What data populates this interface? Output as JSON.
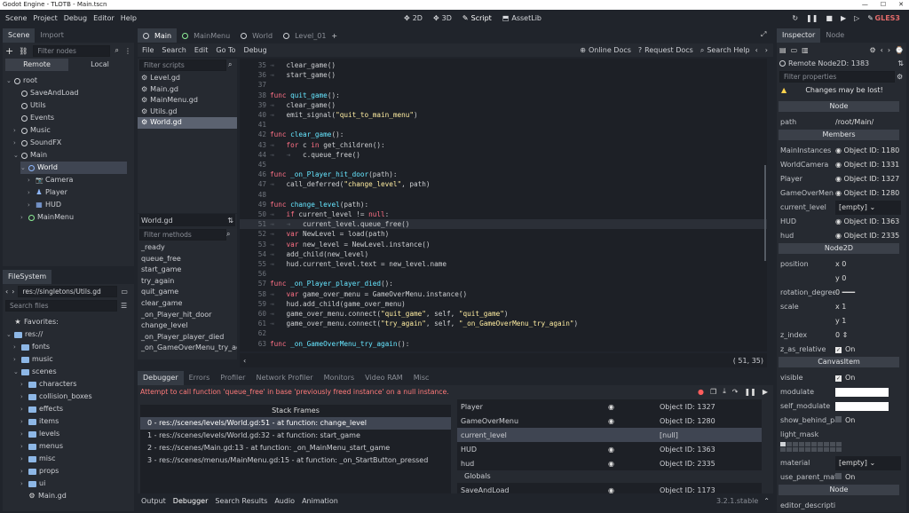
{
  "titlebar": {
    "title": "Godot Engine - TLOTB - Main.tscn"
  },
  "menu": [
    "Scene",
    "Project",
    "Debug",
    "Editor",
    "Help"
  ],
  "main_buttons": [
    {
      "label": "2D",
      "icon": "2d-icon"
    },
    {
      "label": "3D",
      "icon": "3d-icon"
    },
    {
      "label": "Script",
      "icon": "script-icon",
      "active": true
    },
    {
      "label": "AssetLib",
      "icon": "assetlib-icon"
    }
  ],
  "renderer": "GLES3",
  "scene_panel": {
    "tabs": [
      "Scene",
      "Import"
    ],
    "filter_placeholder": "Filter nodes",
    "remote_label": "Remote",
    "local_label": "Local",
    "tree": [
      {
        "label": "root",
        "depth": 0,
        "icon": "ring"
      },
      {
        "label": "SaveAndLoad",
        "depth": 1,
        "icon": "ring"
      },
      {
        "label": "Utils",
        "depth": 1,
        "icon": "ring"
      },
      {
        "label": "Events",
        "depth": 1,
        "icon": "ring"
      },
      {
        "label": "Music",
        "depth": 1,
        "icon": "ring"
      },
      {
        "label": "SoundFX",
        "depth": 1,
        "icon": "ring"
      },
      {
        "label": "Main",
        "depth": 1,
        "icon": "ring"
      },
      {
        "label": "World",
        "depth": 2,
        "icon": "ring-blue"
      },
      {
        "label": "Camera",
        "depth": 3,
        "icon": "camera"
      },
      {
        "label": "Player",
        "depth": 3,
        "icon": "player"
      },
      {
        "label": "HUD",
        "depth": 3,
        "icon": "hud"
      },
      {
        "label": "MainMenu",
        "depth": 2,
        "icon": "ring-green"
      }
    ]
  },
  "filesystem": {
    "title": "FileSystem",
    "path": "res://singletons/Utils.gd",
    "search_placeholder": "Search files",
    "items": [
      {
        "label": "Favorites:",
        "depth": 0,
        "icon": "star"
      },
      {
        "label": "res://",
        "depth": 0,
        "icon": "folder"
      },
      {
        "label": "fonts",
        "depth": 1,
        "icon": "folder"
      },
      {
        "label": "music",
        "depth": 1,
        "icon": "folder"
      },
      {
        "label": "scenes",
        "depth": 1,
        "icon": "folder"
      },
      {
        "label": "characters",
        "depth": 2,
        "icon": "folder"
      },
      {
        "label": "collision_boxes",
        "depth": 2,
        "icon": "folder"
      },
      {
        "label": "effects",
        "depth": 2,
        "icon": "folder"
      },
      {
        "label": "items",
        "depth": 2,
        "icon": "folder"
      },
      {
        "label": "levels",
        "depth": 2,
        "icon": "folder"
      },
      {
        "label": "menus",
        "depth": 2,
        "icon": "folder"
      },
      {
        "label": "misc",
        "depth": 2,
        "icon": "folder"
      },
      {
        "label": "props",
        "depth": 2,
        "icon": "folder"
      },
      {
        "label": "ui",
        "depth": 2,
        "icon": "folder"
      },
      {
        "label": "Main.gd",
        "depth": 2,
        "icon": "gear"
      }
    ]
  },
  "scene_tabs": [
    "Main",
    "MainMenu",
    "World",
    "Level_01"
  ],
  "script_menu": [
    "File",
    "Search",
    "Edit",
    "Go To",
    "Debug"
  ],
  "script_tools": [
    "Online Docs",
    "Request Docs",
    "Search Help"
  ],
  "scripts_filter": "Filter scripts",
  "scripts": [
    "Level.gd",
    "Main.gd",
    "MainMenu.gd",
    "Utils.gd",
    "World.gd"
  ],
  "current_script": "World.gd",
  "methods_filter": "Filter methods",
  "methods": [
    "_ready",
    "queue_free",
    "start_game",
    "try_again",
    "quit_game",
    "clear_game",
    "_on_Player_hit_door",
    "change_level",
    "_on_Player_player_died",
    "_on_GameOverMenu_try_again"
  ],
  "code": [
    {
      "n": "35",
      "i": 1,
      "t": [
        [
          "tx",
          "clear_game()"
        ]
      ]
    },
    {
      "n": "36",
      "i": 1,
      "t": [
        [
          "tx",
          "start_game()"
        ]
      ]
    },
    {
      "n": "37",
      "i": 0,
      "t": []
    },
    {
      "n": "38",
      "i": 0,
      "t": [
        [
          "kw",
          "func "
        ],
        [
          "fn",
          "quit_game"
        ],
        [
          "tx",
          "():"
        ]
      ]
    },
    {
      "n": "39",
      "i": 1,
      "t": [
        [
          "tx",
          "clear_game()"
        ]
      ]
    },
    {
      "n": "40",
      "i": 1,
      "t": [
        [
          "tx",
          "emit_signal("
        ],
        [
          "st",
          "\"quit_to_main_menu\""
        ],
        [
          "tx",
          ")"
        ]
      ]
    },
    {
      "n": "41",
      "i": 0,
      "t": []
    },
    {
      "n": "42",
      "i": 0,
      "t": [
        [
          "kw",
          "func "
        ],
        [
          "fn",
          "clear_game"
        ],
        [
          "tx",
          "():"
        ]
      ]
    },
    {
      "n": "43",
      "i": 1,
      "t": [
        [
          "kw",
          "for "
        ],
        [
          "tx",
          "c "
        ],
        [
          "kw",
          "in "
        ],
        [
          "tx",
          "get_children():"
        ]
      ]
    },
    {
      "n": "44",
      "i": 2,
      "t": [
        [
          "tx",
          "c.queue_free()"
        ]
      ]
    },
    {
      "n": "45",
      "i": 0,
      "t": []
    },
    {
      "n": "46",
      "i": 0,
      "t": [
        [
          "kw",
          "func "
        ],
        [
          "fn",
          "_on_Player_hit_door"
        ],
        [
          "tx",
          "(path):"
        ]
      ]
    },
    {
      "n": "47",
      "i": 1,
      "t": [
        [
          "tx",
          "call_deferred("
        ],
        [
          "st",
          "\"change_level\""
        ],
        [
          "tx",
          ", path)"
        ]
      ]
    },
    {
      "n": "48",
      "i": 0,
      "t": []
    },
    {
      "n": "49",
      "i": 0,
      "t": [
        [
          "kw",
          "func "
        ],
        [
          "fn",
          "change_level"
        ],
        [
          "tx",
          "(path):"
        ]
      ]
    },
    {
      "n": "50",
      "i": 1,
      "t": [
        [
          "kw",
          "if "
        ],
        [
          "tx",
          "current_level != "
        ],
        [
          "kw",
          "null"
        ],
        [
          "tx",
          ":"
        ]
      ]
    },
    {
      "n": "51",
      "i": 2,
      "t": [
        [
          "tx",
          "current_level.queue_free()"
        ]
      ],
      "hl": true
    },
    {
      "n": "52",
      "i": 1,
      "t": [
        [
          "kw",
          "var "
        ],
        [
          "tx",
          "NewLevel = load(path)"
        ]
      ]
    },
    {
      "n": "53",
      "i": 1,
      "t": [
        [
          "kw",
          "var "
        ],
        [
          "tx",
          "new_level = NewLevel.instance()"
        ]
      ]
    },
    {
      "n": "54",
      "i": 1,
      "t": [
        [
          "tx",
          "add_child(new_level)"
        ]
      ]
    },
    {
      "n": "55",
      "i": 1,
      "t": [
        [
          "tx",
          "hud.current_level.text = new_level.name"
        ]
      ]
    },
    {
      "n": "56",
      "i": 0,
      "t": []
    },
    {
      "n": "57",
      "i": 0,
      "t": [
        [
          "kw",
          "func "
        ],
        [
          "fn",
          "_on_Player_player_died"
        ],
        [
          "tx",
          "():"
        ]
      ]
    },
    {
      "n": "58",
      "i": 1,
      "t": [
        [
          "kw",
          "var "
        ],
        [
          "tx",
          "game_over_menu = GameOverMenu.instance()"
        ]
      ]
    },
    {
      "n": "59",
      "i": 1,
      "t": [
        [
          "tx",
          "hud.add_child(game_over_menu)"
        ]
      ]
    },
    {
      "n": "60",
      "i": 1,
      "t": [
        [
          "tx",
          "game_over_menu.connect("
        ],
        [
          "st",
          "\"quit_game\""
        ],
        [
          "tx",
          ", self, "
        ],
        [
          "st",
          "\"quit_game\""
        ],
        [
          "tx",
          ")"
        ]
      ]
    },
    {
      "n": "61",
      "i": 1,
      "t": [
        [
          "tx",
          "game_over_menu.connect("
        ],
        [
          "st",
          "\"try_again\""
        ],
        [
          "tx",
          ", self, "
        ],
        [
          "st",
          "\"_on_GameOverMenu_try_again\""
        ],
        [
          "tx",
          ")"
        ]
      ]
    },
    {
      "n": "62",
      "i": 0,
      "t": []
    },
    {
      "n": "63",
      "i": 0,
      "t": [
        [
          "kw",
          "func "
        ],
        [
          "fn",
          "_on_GameOverMenu_try_again"
        ],
        [
          "tx",
          "():"
        ]
      ]
    }
  ],
  "cursor_pos": "( 51, 35)",
  "debugger": {
    "tabs": [
      "Debugger",
      "Errors",
      "Profiler",
      "Network Profiler",
      "Monitors",
      "Video RAM",
      "Misc"
    ],
    "error": "Attempt to call function 'queue_free' in base 'previously freed instance' on a null instance.",
    "stack_title": "Stack Frames",
    "frames": [
      "0 - res://scenes/levels/World.gd:51 - at function: change_level",
      "1 - res://scenes/levels/World.gd:32 - at function: start_game",
      "2 - res://scenes/Main.gd:13 - at function: _on_MainMenu_start_game",
      "3 - res://scenes/menus/MainMenu.gd:15 - at function: _on_StartButton_pressed"
    ],
    "vars": [
      {
        "k": "Player",
        "v": "Object ID: 1327"
      },
      {
        "k": "GameOverMenu",
        "v": "Object ID: 1280"
      },
      {
        "k": "current_level",
        "v": "[null]"
      },
      {
        "k": "HUD",
        "v": "Object ID: 1363"
      },
      {
        "k": "hud",
        "v": "Object ID: 2335"
      }
    ],
    "globals_label": "Globals",
    "globals": [
      {
        "k": "SaveAndLoad",
        "v": "Object ID: 1173"
      }
    ]
  },
  "bottom_tabs": [
    "Output",
    "Debugger",
    "Search Results",
    "Audio",
    "Animation"
  ],
  "version": "3.2.1.stable",
  "inspector": {
    "tabs": [
      "Inspector",
      "Node"
    ],
    "remote": "Remote Node2D: 1383",
    "filter": "Filter properties",
    "warning": "Changes may be lost!",
    "node_section": "Node",
    "path_k": "path",
    "path_v": "/root/Main/",
    "members_section": "Members",
    "members": [
      {
        "k": "MainInstances",
        "v": "Object ID: 1180"
      },
      {
        "k": "WorldCamera",
        "v": "Object ID: 1331"
      },
      {
        "k": "Player",
        "v": "Object ID: 1327"
      },
      {
        "k": "GameOverMen",
        "v": "Object ID: 1280"
      },
      {
        "k": "current_level",
        "v": "[empty]"
      },
      {
        "k": "HUD",
        "v": "Object ID: 1363"
      },
      {
        "k": "hud",
        "v": "Object ID: 2335"
      }
    ],
    "node2d_section": "Node2D",
    "position_k": "position",
    "pos_x": "0",
    "pos_y": "0",
    "rot_k": "rotation_degrees",
    "rot_v": "0",
    "scale_k": "scale",
    "scale_x": "1",
    "scale_y": "1",
    "zindex_k": "z_index",
    "zindex_v": "0",
    "zrel_k": "z_as_relative",
    "on": "On",
    "canvas_section": "CanvasItem",
    "visible_k": "visible",
    "modulate_k": "modulate",
    "selfmod_k": "self_modulate",
    "behind_k": "show_behind_par",
    "lightmask_k": "light_mask",
    "material_k": "material",
    "material_v": "[empty]",
    "useparent_k": "use_parent_mater",
    "node_footer": "Node",
    "editor_desc": "editor_description"
  }
}
